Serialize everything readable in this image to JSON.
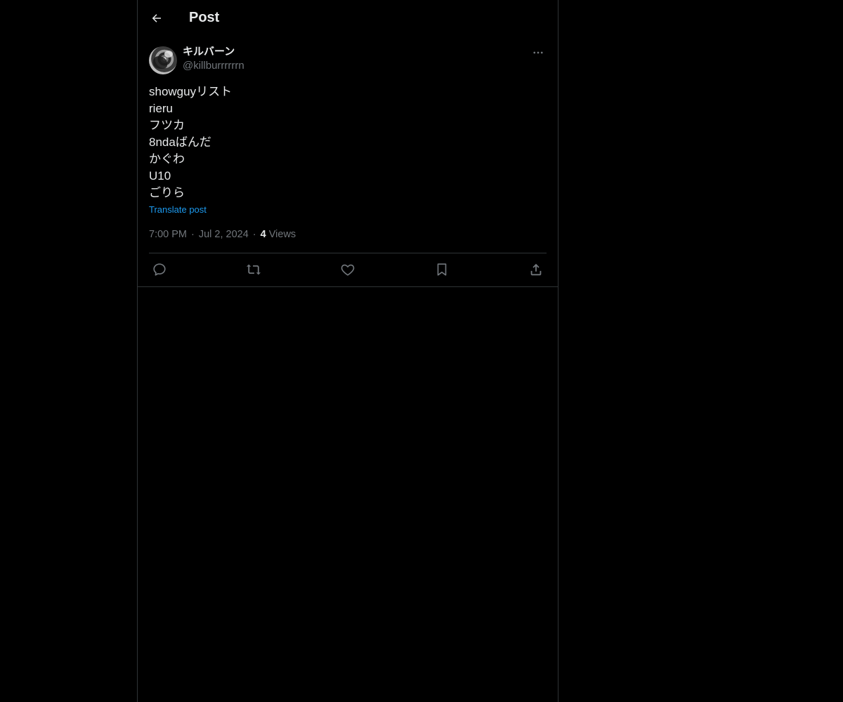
{
  "header": {
    "title": "Post",
    "back_icon": "back-arrow-icon"
  },
  "post": {
    "author": {
      "display_name": "キルバーン",
      "handle": "@killburrrrrrn"
    },
    "lines": [
      "showguyリスト",
      "rieru",
      "フツカ",
      "8ndaばんだ",
      "かぐわ",
      "U10",
      "ごりら"
    ],
    "translate_label": "Translate post",
    "time": "7:00 PM",
    "date": "Jul 2, 2024",
    "views_count": "4",
    "views_label": "Views",
    "separator": "·"
  },
  "actions": [
    {
      "name": "reply",
      "icon": "reply-icon"
    },
    {
      "name": "repost",
      "icon": "repost-icon"
    },
    {
      "name": "like",
      "icon": "heart-icon"
    },
    {
      "name": "bookmark",
      "icon": "bookmark-icon"
    },
    {
      "name": "share",
      "icon": "share-icon"
    }
  ],
  "colors": {
    "background": "#000000",
    "text": "#e7e9ea",
    "muted": "#71767b",
    "link": "#1d9bf0",
    "border": "#2f3336"
  }
}
